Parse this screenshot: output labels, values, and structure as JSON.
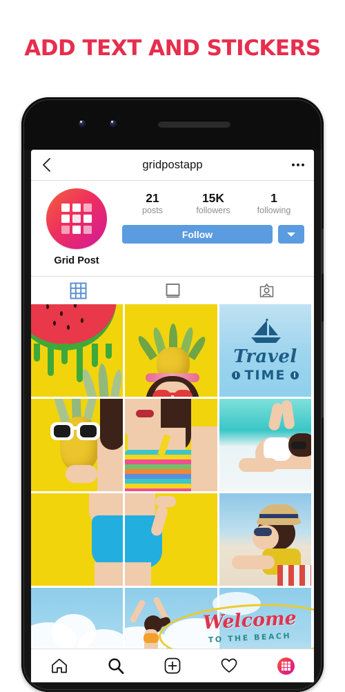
{
  "headline": "ADD TEXT AND STICKERS",
  "colors": {
    "headline_red": "#E62E4D",
    "follow_blue": "#5B9BE0",
    "tab_active_blue": "#5B8FD0",
    "avatar_gradient_start": "#F4613A",
    "avatar_gradient_end": "#D2189C",
    "tile_yellow": "#F2D40C",
    "sky_blue": "#9DD4EE"
  },
  "app_header": {
    "back_icon": "chevron-left-icon",
    "title": "gridpostapp",
    "menu_icon": "kebab-menu-icon"
  },
  "profile": {
    "avatar_icon": "grid-logo-icon",
    "display_name": "Grid Post",
    "stats": [
      {
        "value": "21",
        "label": "posts"
      },
      {
        "value": "15K",
        "label": "followers"
      },
      {
        "value": "1",
        "label": "following"
      }
    ],
    "follow_label": "Follow",
    "dropdown_icon": "chevron-down-icon"
  },
  "tabs": [
    {
      "name": "grid-tab",
      "icon": "grid-icon",
      "active": true
    },
    {
      "name": "list-tab",
      "icon": "list-feed-icon",
      "active": false
    },
    {
      "name": "tagged-tab",
      "icon": "tagged-person-icon",
      "active": false
    }
  ],
  "photo_grid": {
    "rows": 4,
    "columns": 3,
    "tiles": [
      {
        "id": "tile-1-1",
        "art": "watermelon-yellow",
        "caption": "Watermelon slice graphic on yellow"
      },
      {
        "id": "tile-1-2",
        "art": "pineapple-girl-top",
        "caption": "Woman with pineapple headpiece on yellow"
      },
      {
        "id": "tile-1-3",
        "art": "travel-time",
        "caption": "Travel Time sailboat sticker on sky"
      },
      {
        "id": "tile-2-1",
        "art": "pineapple-sunglasses",
        "caption": "Pineapple wearing sunglasses on yellow"
      },
      {
        "id": "tile-2-2",
        "art": "pineapple-girl-mid",
        "caption": "Woman in rainbow striped top"
      },
      {
        "id": "tile-2-3",
        "art": "beach-lying-1",
        "caption": "Woman lying on beach with sunglasses"
      },
      {
        "id": "tile-3-1",
        "art": "yellow-plain",
        "caption": "Yellow background"
      },
      {
        "id": "tile-3-2",
        "art": "blue-swimsuit",
        "caption": "Blue high-waist swimsuit on yellow"
      },
      {
        "id": "tile-3-3",
        "art": "beach-lying-2",
        "caption": "Woman with straw hat on beach towel"
      },
      {
        "id": "tile-4-1",
        "art": "sky-clouds",
        "caption": "Sky and clouds"
      },
      {
        "id": "tile-4-2",
        "art": "sky-woman-arms-up",
        "caption": "Woman in orange bikini arms raised"
      },
      {
        "id": "tile-4-3",
        "art": "welcome-beach",
        "caption": "Welcome to the Beach surfboard sticker"
      }
    ],
    "stickers": {
      "travel_script": "Travel",
      "travel_caps": "TIME",
      "welcome_script": "Welcome",
      "welcome_caps": "TO THE BEACH"
    }
  },
  "bottom_nav": [
    {
      "name": "home",
      "icon": "home-icon"
    },
    {
      "name": "search",
      "icon": "search-icon"
    },
    {
      "name": "add-post",
      "icon": "plus-square-icon"
    },
    {
      "name": "activity",
      "icon": "heart-icon"
    },
    {
      "name": "profile",
      "icon": "profile-avatar-icon"
    }
  ]
}
